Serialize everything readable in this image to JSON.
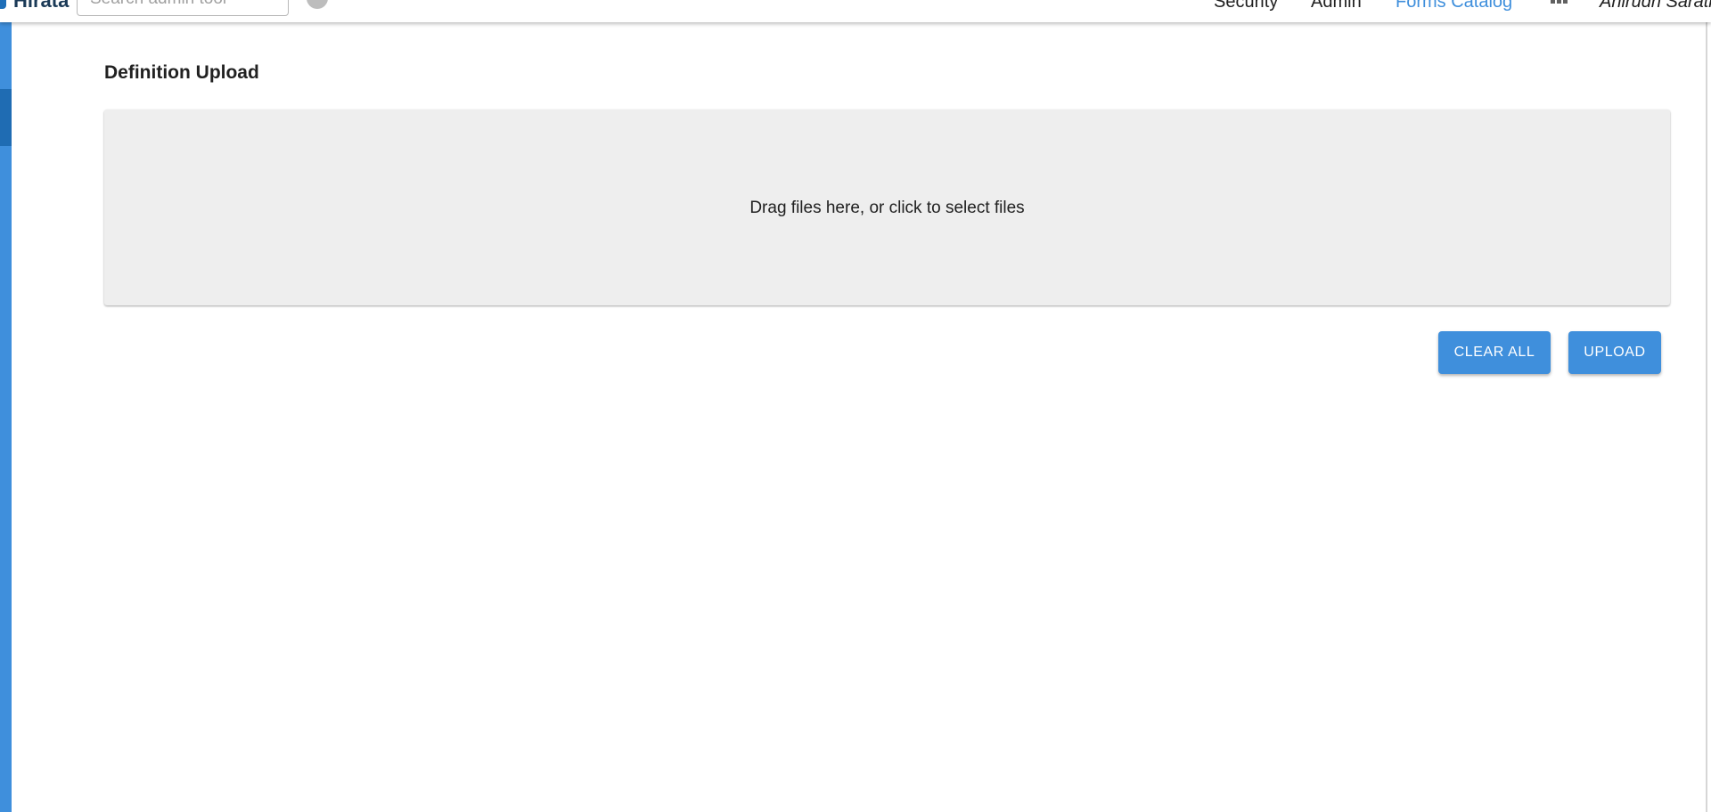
{
  "header": {
    "brand": "Hirata",
    "search_placeholder": "Search admin tool",
    "nav": [
      "Security",
      "Admin",
      "Forms Catalog"
    ],
    "active_nav": "Forms Catalog",
    "user_name": "Anirudh Sarath"
  },
  "main": {
    "title": "Definition Upload",
    "dropzone_text": "Drag files here, or click to select files",
    "clear_label": "CLEAR ALL",
    "upload_label": "UPLOAD"
  },
  "colors": {
    "accent": "#3f8fdc",
    "accent_dark": "#1f6cb3",
    "dropzone_bg": "#eeeeee"
  }
}
